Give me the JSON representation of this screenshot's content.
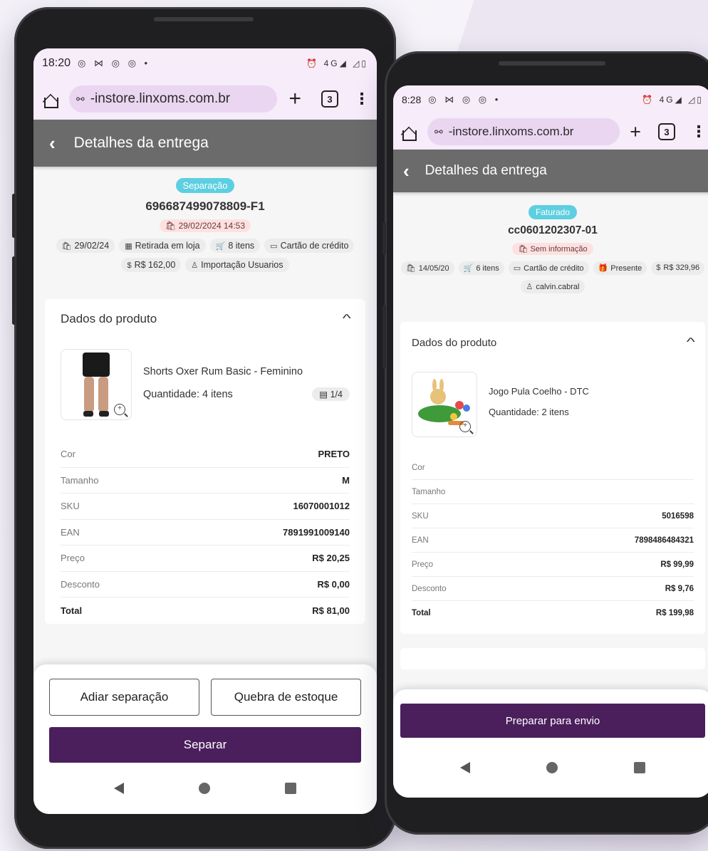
{
  "phone1": {
    "status": {
      "time": "18:20",
      "glyphs": "◎ ⋈ ◎ ◎ •",
      "right": "⏰ 4G◢ ◿▯"
    },
    "browser": {
      "url": "-instore.linxoms.com.br",
      "tab_count": "3"
    },
    "appbar": {
      "title": "Detalhes da entrega"
    },
    "order": {
      "status": "Separação",
      "status_color": "#5dcfe0",
      "id": "696687499078809-F1",
      "date": "29/02/2024 14:53",
      "chips": [
        "29/02/24",
        "Retirada em loja",
        "8 itens",
        "Cartão de crédito",
        "R$ 162,00",
        "Importação Usuarios"
      ]
    },
    "product_card": {
      "title": "Dados do produto",
      "name": "Shorts Oxer Rum Basic - Feminino",
      "quantity": "Quantidade: 4 itens",
      "pack": "1/4",
      "rows": [
        {
          "k": "Cor",
          "v": "PRETO"
        },
        {
          "k": "Tamanho",
          "v": "M"
        },
        {
          "k": "SKU",
          "v": "16070001012"
        },
        {
          "k": "EAN",
          "v": "7891991009140"
        },
        {
          "k": "Preço",
          "v": "R$ 20,25"
        },
        {
          "k": "Desconto",
          "v": "R$ 0,00"
        },
        {
          "k": "Total",
          "v": "R$ 81,00"
        }
      ]
    },
    "actions": {
      "postpone": "Adiar separação",
      "stock_break": "Quebra de estoque",
      "primary": "Separar"
    }
  },
  "phone2": {
    "status": {
      "time": "8:28",
      "glyphs": "◎ ⋈ ◎ ◎ •",
      "right": "⏰ 4G◢ ◿▯"
    },
    "browser": {
      "url": "-instore.linxoms.com.br",
      "tab_count": "3"
    },
    "appbar": {
      "title": "Detalhes da entrega"
    },
    "order": {
      "status": "Faturado",
      "status_color": "#5dcfe0",
      "id": "cc0601202307-01",
      "date": "Sem informação",
      "chips": [
        "14/05/20",
        "6 itens",
        "Cartão de crédito",
        "Presente",
        "R$ 329,96",
        "calvin.cabral"
      ]
    },
    "product_card": {
      "title": "Dados do produto",
      "name": "Jogo Pula Coelho - DTC",
      "quantity": "Quantidade: 2 itens",
      "rows": [
        {
          "k": "Cor",
          "v": ""
        },
        {
          "k": "Tamanho",
          "v": ""
        },
        {
          "k": "SKU",
          "v": "5016598"
        },
        {
          "k": "EAN",
          "v": "7898486484321"
        },
        {
          "k": "Preço",
          "v": "R$ 99,99"
        },
        {
          "k": "Desconto",
          "v": "R$ 9,76"
        },
        {
          "k": "Total",
          "v": "R$ 199,98"
        }
      ]
    },
    "actions": {
      "primary": "Preparar para envio"
    }
  },
  "colors": {
    "primary": "#4a1f5c",
    "appbar": "#6b6b6b",
    "status_pill": "#5dcfe0",
    "date_pill": "#fde1e1"
  }
}
